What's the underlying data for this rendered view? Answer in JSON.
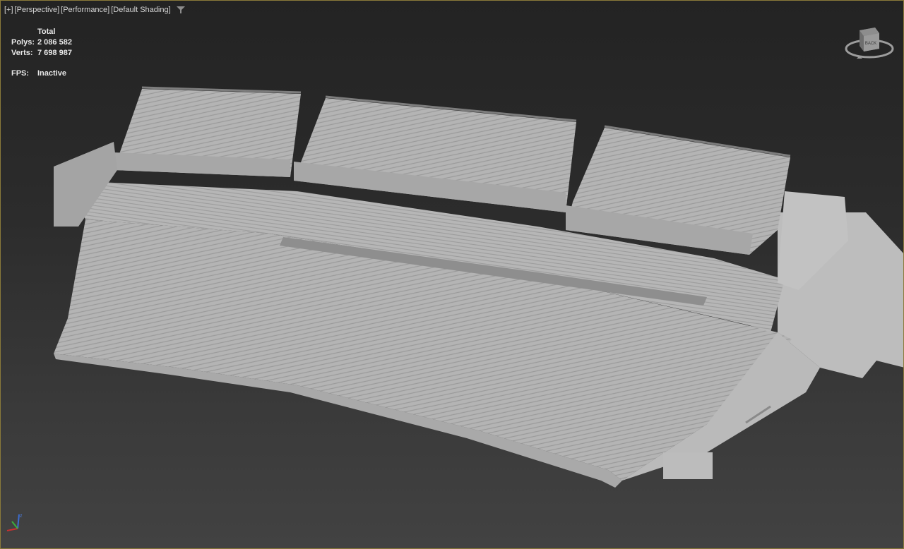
{
  "viewport": {
    "menu_plus": "[+]",
    "view_mode": "[Perspective]",
    "perf_mode": "[Performance]",
    "shading_mode": "[Default Shading]",
    "filter_icon": "funnel-icon"
  },
  "stats": {
    "header": "Total",
    "polys_label": "Polys:",
    "polys_value": "2 086 582",
    "verts_label": "Verts:",
    "verts_value": "7 698 987",
    "fps_label": "FPS:",
    "fps_value": "Inactive"
  },
  "viewcube": {
    "face_label": "BACK",
    "icon": "viewcube-icon"
  },
  "axis_gizmo": {
    "icon": "xyz-axis-icon",
    "z_label": "z"
  },
  "scene": {
    "model": "stadium-grandstand",
    "model_color": "#b9b9b9"
  }
}
